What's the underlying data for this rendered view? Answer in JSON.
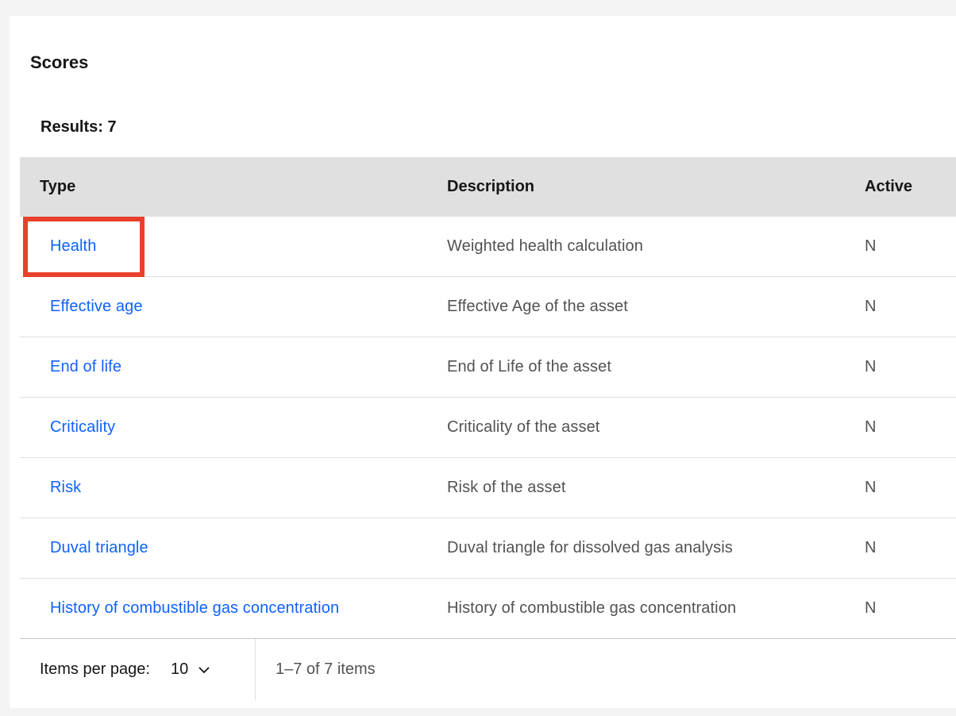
{
  "panel": {
    "title": "Scores"
  },
  "results_label": "Results: 7",
  "table": {
    "headers": {
      "type": "Type",
      "description": "Description",
      "active": "Active"
    },
    "rows": [
      {
        "type": "Health",
        "description": "Weighted health calculation",
        "active": "N"
      },
      {
        "type": "Effective age",
        "description": "Effective Age of the asset",
        "active": "N"
      },
      {
        "type": "End of life",
        "description": "End of Life of the asset",
        "active": "N"
      },
      {
        "type": "Criticality",
        "description": "Criticality of the asset",
        "active": "N"
      },
      {
        "type": "Risk",
        "description": "Risk of the asset",
        "active": "N"
      },
      {
        "type": "Duval triangle",
        "description": "Duval triangle for dissolved gas analysis",
        "active": "N"
      },
      {
        "type": "History of combustible gas concentration",
        "description": "History of combustible gas concentration",
        "active": "N"
      }
    ]
  },
  "pagination": {
    "items_per_page_label": "Items per page:",
    "items_per_page_value": "10",
    "range_text": "1–7 of 7 items",
    "dropdown_icon": "chevron-down-icon"
  },
  "colors": {
    "link": "#0f62fe",
    "header_bg": "#e0e0e0",
    "highlight_border": "#e8402a"
  }
}
